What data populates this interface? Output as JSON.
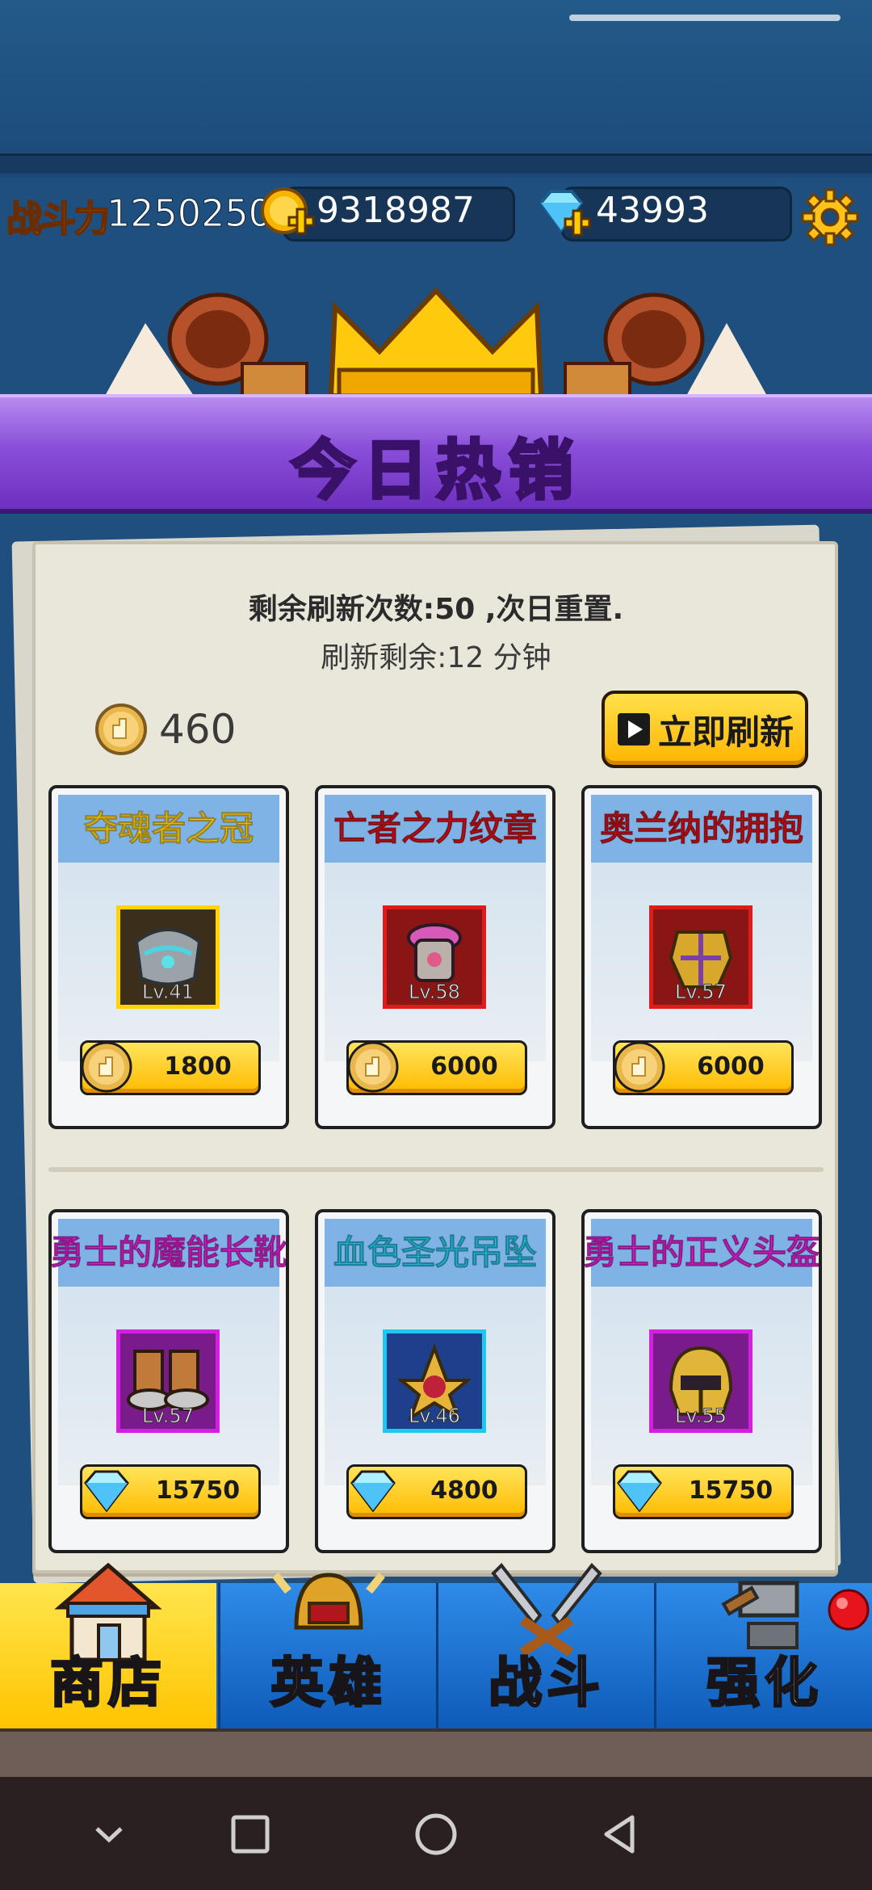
{
  "status": {
    "power_label": "战斗力",
    "power_value": "1250250",
    "gold": "9318987",
    "diamonds": "43993"
  },
  "banner": {
    "title": "今日热销"
  },
  "shop": {
    "refresh_info": "剩余刷新次数:50 ,次日重置.",
    "refresh_timer": "刷新剩余:12 分钟",
    "token_count": "460",
    "refresh_button": "立即刷新",
    "items": [
      {
        "name": "夺魂者之冠",
        "name_color": "#ffd21a",
        "level": "Lv.41",
        "frame": "#ffd400",
        "price": "1800",
        "currency": "token"
      },
      {
        "name": "亡者之力纹章",
        "name_color": "#d4101a",
        "level": "Lv.58",
        "frame": "#e01b1b",
        "price": "6000",
        "currency": "token"
      },
      {
        "name": "奥兰纳的拥抱",
        "name_color": "#d4101a",
        "level": "Lv.57",
        "frame": "#e01b1b",
        "price": "6000",
        "currency": "token"
      },
      {
        "name": "勇士的魔能长靴",
        "name_color": "#e21fd6",
        "level": "Lv.57",
        "frame": "#d51fe0",
        "price": "15750",
        "currency": "diamond"
      },
      {
        "name": "血色圣光吊坠",
        "name_color": "#26c6e8",
        "level": "Lv.46",
        "frame": "#1fc7f0",
        "price": "4800",
        "currency": "diamond"
      },
      {
        "name": "勇士的正义头盔",
        "name_color": "#e21fd6",
        "level": "Lv.55",
        "frame": "#d51fe0",
        "price": "15750",
        "currency": "diamond"
      }
    ]
  },
  "tabs": [
    {
      "label": "商店",
      "active": true
    },
    {
      "label": "英雄",
      "active": false
    },
    {
      "label": "战斗",
      "active": false
    },
    {
      "label": "强化",
      "active": false
    }
  ]
}
